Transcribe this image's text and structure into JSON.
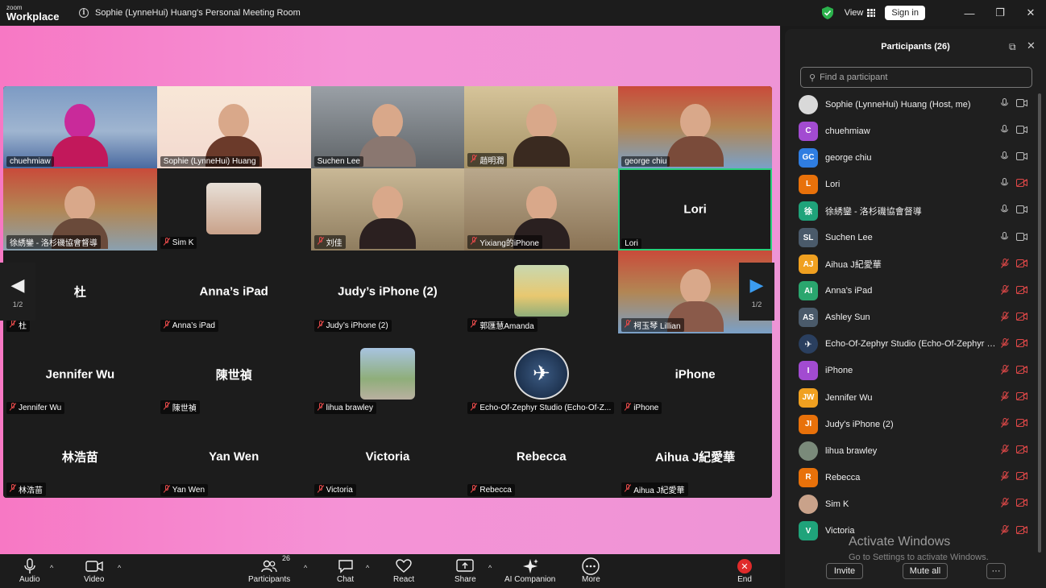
{
  "titlebar": {
    "logo_top": "zoom",
    "logo_bottom": "Workplace",
    "meeting_title": "Sophie (LynneHui) Huang's Personal Meeting Room",
    "view_label": "View",
    "signin_label": "Sign in"
  },
  "grid": {
    "page_indicator": "1/2",
    "tiles": [
      {
        "name": "chuehmiaw",
        "type": "video",
        "muted": false
      },
      {
        "name": "Sophie (LynneHui) Huang",
        "type": "video",
        "muted": false
      },
      {
        "name": "Suchen Lee",
        "type": "video",
        "muted": false
      },
      {
        "name": "趙明潤",
        "type": "video",
        "muted": true
      },
      {
        "name": "george chiu",
        "type": "video",
        "muted": false
      },
      {
        "name": "徐綉鑾 - 洛杉磯協會督導",
        "type": "video",
        "muted": false
      },
      {
        "name": "Sim K",
        "type": "avatar",
        "muted": true
      },
      {
        "name": "刘佳",
        "type": "video",
        "muted": true
      },
      {
        "name": "Yixiang的iPhone",
        "type": "video",
        "muted": true
      },
      {
        "name": "Lori",
        "big": "Lori",
        "type": "text",
        "muted": false,
        "active": true
      },
      {
        "name": "杜",
        "big": "杜",
        "type": "text",
        "muted": true
      },
      {
        "name": "Anna’s iPad",
        "big": "Anna’s iPad",
        "type": "text",
        "muted": true
      },
      {
        "name": "Judy’s iPhone (2)",
        "big": "Judy’s iPhone (2)",
        "type": "text",
        "muted": true
      },
      {
        "name": "郭匯慧Amanda",
        "type": "avatar",
        "muted": true
      },
      {
        "name": "柯玉琴 Lillian",
        "type": "video",
        "muted": true
      },
      {
        "name": "Jennifer Wu",
        "big": "Jennifer Wu",
        "type": "text",
        "muted": true
      },
      {
        "name": "陳世禎",
        "big": "陳世禎",
        "type": "text",
        "muted": true
      },
      {
        "name": "lihua brawley",
        "type": "avatar",
        "muted": true
      },
      {
        "name": "Echo-Of-Zephyr Studio (Echo-Of-Z...",
        "type": "avatar",
        "muted": true
      },
      {
        "name": "iPhone",
        "big": "iPhone",
        "type": "text",
        "muted": true
      },
      {
        "name": "林浩苗",
        "big": "林浩苗",
        "type": "text",
        "muted": true
      },
      {
        "name": "Yan Wen",
        "big": "Yan Wen",
        "type": "text",
        "muted": true
      },
      {
        "name": "Victoria",
        "big": "Victoria",
        "type": "text",
        "muted": true
      },
      {
        "name": "Rebecca",
        "big": "Rebecca",
        "type": "text",
        "muted": true
      },
      {
        "name": "Aihua J紀愛華",
        "big": "Aihua J紀愛華",
        "type": "text",
        "muted": true
      }
    ]
  },
  "toolbar": {
    "audio": "Audio",
    "video": "Video",
    "participants": "Participants",
    "participants_count": "26",
    "chat": "Chat",
    "react": "React",
    "share": "Share",
    "ai_companion": "AI Companion",
    "more": "More",
    "end": "End"
  },
  "panel": {
    "title": "Participants (26)",
    "search_placeholder": "Find a participant",
    "participants": [
      {
        "initials": "",
        "name": "Sophie (LynneHui) Huang (Host, me)",
        "color": "#d9d9d9",
        "mic": true,
        "cam": true,
        "photo": true
      },
      {
        "initials": "C",
        "name": "chuehmiaw",
        "color": "#a24bd1",
        "mic": true,
        "cam": true
      },
      {
        "initials": "GC",
        "name": "george chiu",
        "color": "#2f7de1",
        "mic": true,
        "cam": true
      },
      {
        "initials": "L",
        "name": "Lori",
        "color": "#e8710a",
        "mic": true,
        "cam": false
      },
      {
        "initials": "徐",
        "name": "徐綉鑾 - 洛杉磯協會督導",
        "color": "#1fa37a",
        "mic": true,
        "cam": true
      },
      {
        "initials": "SL",
        "name": "Suchen Lee",
        "color": "#4a5a6a",
        "mic": true,
        "cam": true
      },
      {
        "initials": "AJ",
        "name": "Aihua J紀愛華",
        "color": "#f0a020",
        "mic": false,
        "cam": false
      },
      {
        "initials": "AI",
        "name": "Anna's iPad",
        "color": "#2aa66e",
        "mic": false,
        "cam": false
      },
      {
        "initials": "AS",
        "name": "Ashley Sun",
        "color": "#4a5a6a",
        "mic": false,
        "cam": false
      },
      {
        "initials": "",
        "name": "Echo-Of-Zephyr Studio (Echo-Of-Zephyr St...",
        "color": "#2a3f5f",
        "mic": false,
        "cam": false,
        "photo": true
      },
      {
        "initials": "I",
        "name": "iPhone",
        "color": "#a24bd1",
        "mic": false,
        "cam": false
      },
      {
        "initials": "JW",
        "name": "Jennifer Wu",
        "color": "#f0a020",
        "mic": false,
        "cam": false
      },
      {
        "initials": "JI",
        "name": "Judy's iPhone (2)",
        "color": "#e8710a",
        "mic": false,
        "cam": false
      },
      {
        "initials": "",
        "name": "lihua brawley",
        "color": "#7a8a7a",
        "mic": false,
        "cam": false,
        "photo": true
      },
      {
        "initials": "R",
        "name": "Rebecca",
        "color": "#e8710a",
        "mic": false,
        "cam": false
      },
      {
        "initials": "",
        "name": "Sim K",
        "color": "#c9a28a",
        "mic": false,
        "cam": false,
        "photo": true
      },
      {
        "initials": "V",
        "name": "Victoria",
        "color": "#1fa37a",
        "mic": false,
        "cam": false
      }
    ],
    "invite": "Invite",
    "mute_all": "Mute all",
    "more": "···"
  },
  "watermark": {
    "title": "Activate Windows",
    "subtitle": "Go to Settings to activate Windows."
  }
}
